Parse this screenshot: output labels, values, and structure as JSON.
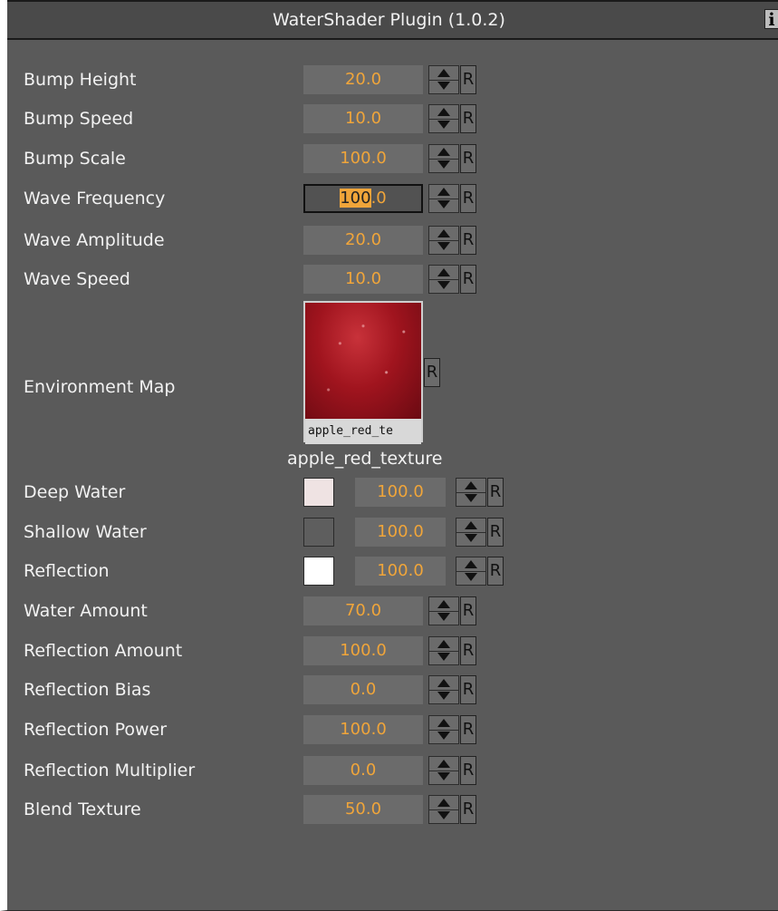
{
  "window": {
    "title": "WaterShader Plugin (1.0.2)",
    "info_label": "i"
  },
  "reset_label": "R",
  "rows": [
    {
      "label": "Bump Height",
      "value": "20.0"
    },
    {
      "label": "Bump Speed",
      "value": "10.0"
    },
    {
      "label": "Bump Scale",
      "value": "100.0"
    },
    {
      "label": "Wave Frequency",
      "value": "100.0",
      "value_selected": "100",
      "value_rest": ".0"
    },
    {
      "label": "Wave Amplitude",
      "value": "20.0"
    },
    {
      "label": "Wave Speed",
      "value": "10.0"
    }
  ],
  "environment_map": {
    "label": "Environment Map",
    "thumbnail_caption": "apple_red_te",
    "texture_name": "apple_red_texture"
  },
  "colors": [
    {
      "label": "Deep Water",
      "swatch": "#efe3e3",
      "value": "100.0"
    },
    {
      "label": "Shallow Water",
      "swatch": "#5e5e5e",
      "value": "100.0"
    },
    {
      "label": "Reflection",
      "swatch": "#ffffff",
      "value": "100.0"
    }
  ],
  "rows2": [
    {
      "label": "Water Amount",
      "value": "70.0"
    },
    {
      "label": "Reflection Amount",
      "value": "100.0"
    },
    {
      "label": "Reflection Bias",
      "value": "0.0"
    },
    {
      "label": "Reflection Power",
      "value": "100.0"
    },
    {
      "label": "Reflection Multiplier",
      "value": "0.0"
    },
    {
      "label": "Blend Texture",
      "value": "50.0"
    }
  ],
  "theme": {
    "panel_bg": "#5a5a5a",
    "field_bg": "#6b6b6b",
    "value_color": "#f0a53a"
  }
}
